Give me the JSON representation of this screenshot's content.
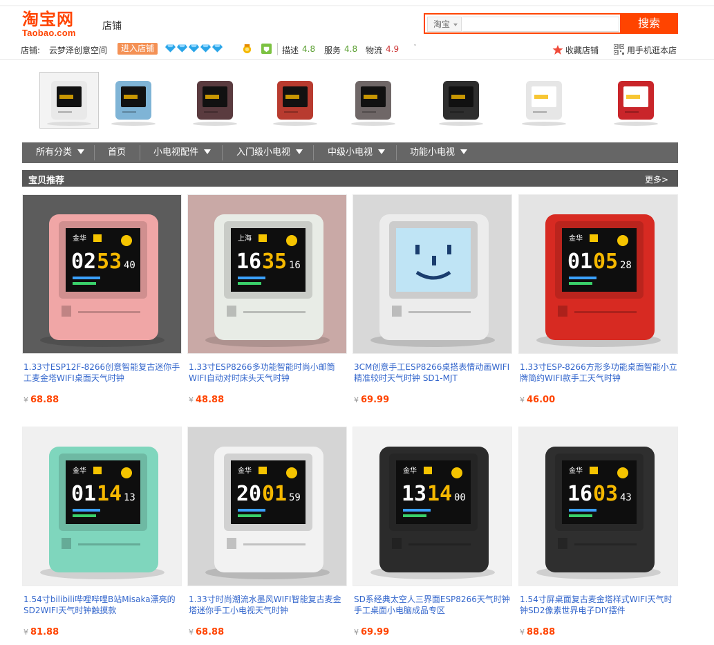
{
  "header": {
    "logo_main": "淘宝网",
    "logo_sub": "Taobao.com",
    "section_label": "店铺"
  },
  "search": {
    "scope": "淘宝",
    "placeholder": "",
    "button": "搜索"
  },
  "shop": {
    "label": "店铺:",
    "name": "云梦泽创意空间",
    "enter_label": "进入店铺",
    "ratings": [
      {
        "label": "描述",
        "value": "4.8",
        "color": "#5a9f31"
      },
      {
        "label": "服务",
        "value": "4.8",
        "color": "#5a9f31"
      },
      {
        "label": "物流",
        "value": "4.9",
        "color": "#cc3333"
      }
    ],
    "favorite_label": "收藏店铺",
    "mobile_label": "用手机逛本店"
  },
  "thumbnails": [
    {
      "color": "#e9e9e9",
      "screen": "#111"
    },
    {
      "color": "#7fb4d6",
      "screen": "#111"
    },
    {
      "color": "#5a3b3f",
      "screen": "#111"
    },
    {
      "color": "#b83b2f",
      "screen": "#111"
    },
    {
      "color": "#6f6767",
      "screen": "#111"
    },
    {
      "color": "#2e2e2e",
      "screen": "#111"
    },
    {
      "color": "#e6e6e6",
      "screen": "#fff"
    },
    {
      "color": "#c9252a",
      "screen": "#fff"
    }
  ],
  "nav": {
    "items": [
      {
        "label": "所有分类",
        "dropdown": true
      },
      {
        "label": "首页",
        "dropdown": false
      },
      {
        "label": "小电视配件",
        "dropdown": true
      },
      {
        "label": "入门级小电视",
        "dropdown": true
      },
      {
        "label": "中级小电视",
        "dropdown": true
      },
      {
        "label": "功能小电视",
        "dropdown": true
      }
    ]
  },
  "section": {
    "title": "宝贝推荐",
    "more": "更多>"
  },
  "products": [
    {
      "title": "1.33寸ESP12F-8266创意智能复古迷你手工麦金塔WIFI桌面天气时钟",
      "price": "68.88",
      "body": "#f0a6a6",
      "screen_time": "0253",
      "screen_sec": "40",
      "screen_city": "金华",
      "bg": "#5c5c5c"
    },
    {
      "title": "1.33寸ESP8266多功能智能时尚小邮筒WIFI自动对时床头天气时钟",
      "price": "48.88",
      "body": "#e8ece6",
      "screen_time": "1635",
      "screen_sec": "16",
      "screen_city": "上海",
      "bg": "#c9a9a6"
    },
    {
      "title": "3CM创意手工ESP8266桌搭表情动画WIFI精准较时天气时钟 SD1-MJT",
      "price": "69.99",
      "body": "#ececec",
      "screen_time": "",
      "screen_sec": "",
      "screen_city": "",
      "bg": "#d8d8d8"
    },
    {
      "title": "1.33寸ESP-8266方形多功能桌面智能小立牌简约WIFI款手工天气时钟",
      "price": "46.00",
      "body": "#d72a22",
      "screen_time": "0105",
      "screen_sec": "28",
      "screen_city": "金华",
      "bg": "#e4e4e4"
    },
    {
      "title": "1.54寸bilibili哔哩哔哩B站Misaka漂亮的SD2WIFI天气时钟触摸款",
      "price": "81.88",
      "body": "#7fd6bd",
      "screen_time": "0114",
      "screen_sec": "13",
      "screen_city": "金华",
      "bg": "#f0f0f0"
    },
    {
      "title": "1.33寸时尚潮流水墨风WIFI智能复古麦金塔迷你手工小电视天气时钟",
      "price": "68.88",
      "body": "#f2f2f2",
      "screen_time": "2001",
      "screen_sec": "59",
      "screen_city": "金华",
      "bg": "#d5d5d5"
    },
    {
      "title": "SD系经典太空人三界面ESP8266天气时钟手工桌面小电脑成品专区",
      "price": "69.99",
      "body": "#2b2b2b",
      "screen_time": "1314",
      "screen_sec": "00",
      "screen_city": "金华",
      "bg": "#f2f2f2"
    },
    {
      "title": "1.54寸屏桌面复古麦金塔样式WIFI天气时钟SD2像素世界电子DIY摆件",
      "price": "88.88",
      "body": "#2f2f2f",
      "screen_time": "1603",
      "screen_sec": "43",
      "screen_city": "金华",
      "bg": "#efefef"
    }
  ]
}
